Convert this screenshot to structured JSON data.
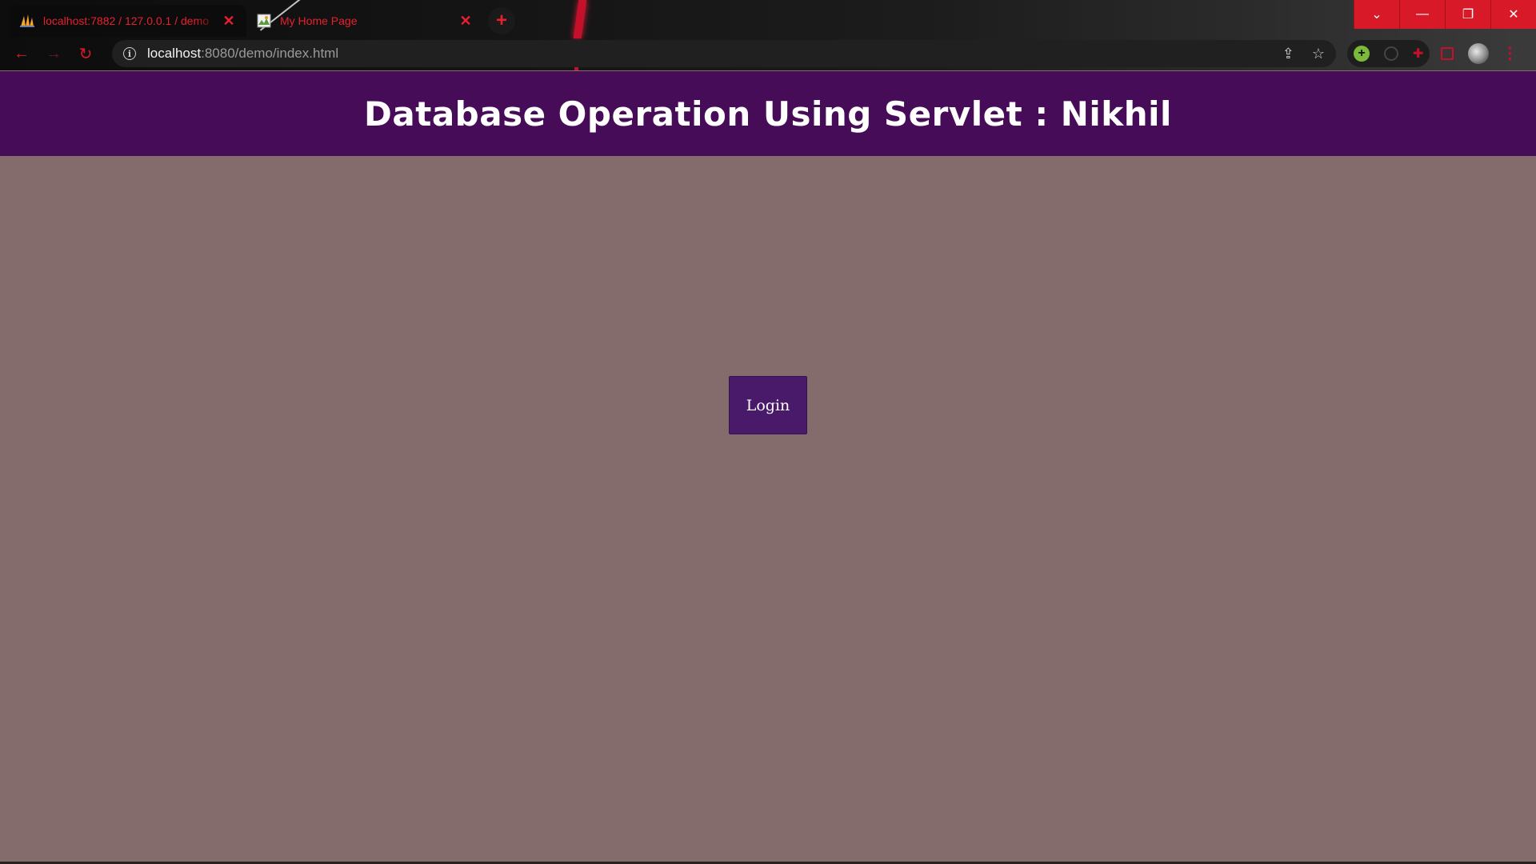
{
  "browser": {
    "tabs": [
      {
        "title": "localhost:7882 / 127.0.0.1 / demo",
        "active": true,
        "favicon": "phpmyadmin-sail-icon"
      },
      {
        "title": "My Home Page",
        "active": false,
        "favicon": "broken-image-icon"
      }
    ],
    "new_tab": "+",
    "window_controls": {
      "tab_search": "⌄",
      "minimize": "—",
      "restore": "❐",
      "close": "✕"
    },
    "nav": {
      "back": "←",
      "forward": "→",
      "reload": "↻"
    },
    "url": {
      "host": "localhost",
      "path": ":8080/demo/index.html"
    },
    "icons": {
      "share": "⇪",
      "bookmark": "☆",
      "menu": "⋮"
    },
    "accent_color": "#d81a28"
  },
  "page": {
    "title": "Database Operation Using Servlet : Nikhil",
    "login_label": "Login",
    "header_color": "#470c58",
    "background_color": "#846c6c",
    "button_color": "#4a1a6a"
  }
}
